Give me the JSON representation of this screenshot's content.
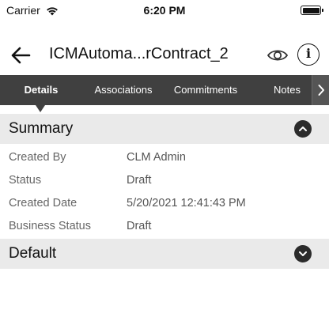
{
  "status_bar": {
    "carrier": "Carrier",
    "time": "6:20 PM"
  },
  "nav": {
    "title": "ICMAutoma...rContract_2",
    "info_glyph": "i"
  },
  "tabs": [
    {
      "label": "Details",
      "active": true
    },
    {
      "label": "Associations",
      "active": false
    },
    {
      "label": "Commitments",
      "active": false
    },
    {
      "label": "Notes",
      "active": false
    }
  ],
  "sections": {
    "summary": {
      "title": "Summary",
      "expanded": true,
      "fields": [
        {
          "label": "Created By",
          "value": "CLM Admin"
        },
        {
          "label": "Status",
          "value": "Draft"
        },
        {
          "label": "Created Date",
          "value": "5/20/2021 12:41:43 PM"
        },
        {
          "label": "Business Status",
          "value": "Draft"
        }
      ]
    },
    "default": {
      "title": "Default",
      "expanded": false
    }
  },
  "colors": {
    "tab_bar": "#404040",
    "section_header": "#eaeaea",
    "toggle_button": "#2b2b2b"
  },
  "icons": [
    "wifi-icon",
    "battery-icon",
    "back-arrow-icon",
    "eye-icon",
    "info-icon",
    "chevron-right-icon",
    "chevron-up-icon",
    "chevron-down-icon"
  ]
}
